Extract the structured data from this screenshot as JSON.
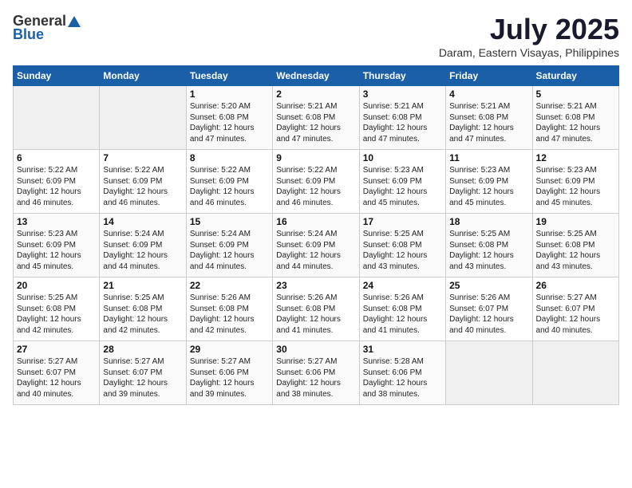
{
  "header": {
    "logo_general": "General",
    "logo_blue": "Blue",
    "month_title": "July 2025",
    "location": "Daram, Eastern Visayas, Philippines"
  },
  "weekdays": [
    "Sunday",
    "Monday",
    "Tuesday",
    "Wednesday",
    "Thursday",
    "Friday",
    "Saturday"
  ],
  "days": [
    {
      "date": "",
      "sunrise": "",
      "sunset": "",
      "daylight": ""
    },
    {
      "date": "",
      "sunrise": "",
      "sunset": "",
      "daylight": ""
    },
    {
      "date": "1",
      "sunrise": "Sunrise: 5:20 AM",
      "sunset": "Sunset: 6:08 PM",
      "daylight": "Daylight: 12 hours and 47 minutes."
    },
    {
      "date": "2",
      "sunrise": "Sunrise: 5:21 AM",
      "sunset": "Sunset: 6:08 PM",
      "daylight": "Daylight: 12 hours and 47 minutes."
    },
    {
      "date": "3",
      "sunrise": "Sunrise: 5:21 AM",
      "sunset": "Sunset: 6:08 PM",
      "daylight": "Daylight: 12 hours and 47 minutes."
    },
    {
      "date": "4",
      "sunrise": "Sunrise: 5:21 AM",
      "sunset": "Sunset: 6:08 PM",
      "daylight": "Daylight: 12 hours and 47 minutes."
    },
    {
      "date": "5",
      "sunrise": "Sunrise: 5:21 AM",
      "sunset": "Sunset: 6:08 PM",
      "daylight": "Daylight: 12 hours and 47 minutes."
    },
    {
      "date": "6",
      "sunrise": "Sunrise: 5:22 AM",
      "sunset": "Sunset: 6:09 PM",
      "daylight": "Daylight: 12 hours and 46 minutes."
    },
    {
      "date": "7",
      "sunrise": "Sunrise: 5:22 AM",
      "sunset": "Sunset: 6:09 PM",
      "daylight": "Daylight: 12 hours and 46 minutes."
    },
    {
      "date": "8",
      "sunrise": "Sunrise: 5:22 AM",
      "sunset": "Sunset: 6:09 PM",
      "daylight": "Daylight: 12 hours and 46 minutes."
    },
    {
      "date": "9",
      "sunrise": "Sunrise: 5:22 AM",
      "sunset": "Sunset: 6:09 PM",
      "daylight": "Daylight: 12 hours and 46 minutes."
    },
    {
      "date": "10",
      "sunrise": "Sunrise: 5:23 AM",
      "sunset": "Sunset: 6:09 PM",
      "daylight": "Daylight: 12 hours and 45 minutes."
    },
    {
      "date": "11",
      "sunrise": "Sunrise: 5:23 AM",
      "sunset": "Sunset: 6:09 PM",
      "daylight": "Daylight: 12 hours and 45 minutes."
    },
    {
      "date": "12",
      "sunrise": "Sunrise: 5:23 AM",
      "sunset": "Sunset: 6:09 PM",
      "daylight": "Daylight: 12 hours and 45 minutes."
    },
    {
      "date": "13",
      "sunrise": "Sunrise: 5:23 AM",
      "sunset": "Sunset: 6:09 PM",
      "daylight": "Daylight: 12 hours and 45 minutes."
    },
    {
      "date": "14",
      "sunrise": "Sunrise: 5:24 AM",
      "sunset": "Sunset: 6:09 PM",
      "daylight": "Daylight: 12 hours and 44 minutes."
    },
    {
      "date": "15",
      "sunrise": "Sunrise: 5:24 AM",
      "sunset": "Sunset: 6:09 PM",
      "daylight": "Daylight: 12 hours and 44 minutes."
    },
    {
      "date": "16",
      "sunrise": "Sunrise: 5:24 AM",
      "sunset": "Sunset: 6:09 PM",
      "daylight": "Daylight: 12 hours and 44 minutes."
    },
    {
      "date": "17",
      "sunrise": "Sunrise: 5:25 AM",
      "sunset": "Sunset: 6:08 PM",
      "daylight": "Daylight: 12 hours and 43 minutes."
    },
    {
      "date": "18",
      "sunrise": "Sunrise: 5:25 AM",
      "sunset": "Sunset: 6:08 PM",
      "daylight": "Daylight: 12 hours and 43 minutes."
    },
    {
      "date": "19",
      "sunrise": "Sunrise: 5:25 AM",
      "sunset": "Sunset: 6:08 PM",
      "daylight": "Daylight: 12 hours and 43 minutes."
    },
    {
      "date": "20",
      "sunrise": "Sunrise: 5:25 AM",
      "sunset": "Sunset: 6:08 PM",
      "daylight": "Daylight: 12 hours and 42 minutes."
    },
    {
      "date": "21",
      "sunrise": "Sunrise: 5:25 AM",
      "sunset": "Sunset: 6:08 PM",
      "daylight": "Daylight: 12 hours and 42 minutes."
    },
    {
      "date": "22",
      "sunrise": "Sunrise: 5:26 AM",
      "sunset": "Sunset: 6:08 PM",
      "daylight": "Daylight: 12 hours and 42 minutes."
    },
    {
      "date": "23",
      "sunrise": "Sunrise: 5:26 AM",
      "sunset": "Sunset: 6:08 PM",
      "daylight": "Daylight: 12 hours and 41 minutes."
    },
    {
      "date": "24",
      "sunrise": "Sunrise: 5:26 AM",
      "sunset": "Sunset: 6:08 PM",
      "daylight": "Daylight: 12 hours and 41 minutes."
    },
    {
      "date": "25",
      "sunrise": "Sunrise: 5:26 AM",
      "sunset": "Sunset: 6:07 PM",
      "daylight": "Daylight: 12 hours and 40 minutes."
    },
    {
      "date": "26",
      "sunrise": "Sunrise: 5:27 AM",
      "sunset": "Sunset: 6:07 PM",
      "daylight": "Daylight: 12 hours and 40 minutes."
    },
    {
      "date": "27",
      "sunrise": "Sunrise: 5:27 AM",
      "sunset": "Sunset: 6:07 PM",
      "daylight": "Daylight: 12 hours and 40 minutes."
    },
    {
      "date": "28",
      "sunrise": "Sunrise: 5:27 AM",
      "sunset": "Sunset: 6:07 PM",
      "daylight": "Daylight: 12 hours and 39 minutes."
    },
    {
      "date": "29",
      "sunrise": "Sunrise: 5:27 AM",
      "sunset": "Sunset: 6:06 PM",
      "daylight": "Daylight: 12 hours and 39 minutes."
    },
    {
      "date": "30",
      "sunrise": "Sunrise: 5:27 AM",
      "sunset": "Sunset: 6:06 PM",
      "daylight": "Daylight: 12 hours and 38 minutes."
    },
    {
      "date": "31",
      "sunrise": "Sunrise: 5:28 AM",
      "sunset": "Sunset: 6:06 PM",
      "daylight": "Daylight: 12 hours and 38 minutes."
    },
    {
      "date": "",
      "sunrise": "",
      "sunset": "",
      "daylight": ""
    },
    {
      "date": "",
      "sunrise": "",
      "sunset": "",
      "daylight": ""
    }
  ]
}
